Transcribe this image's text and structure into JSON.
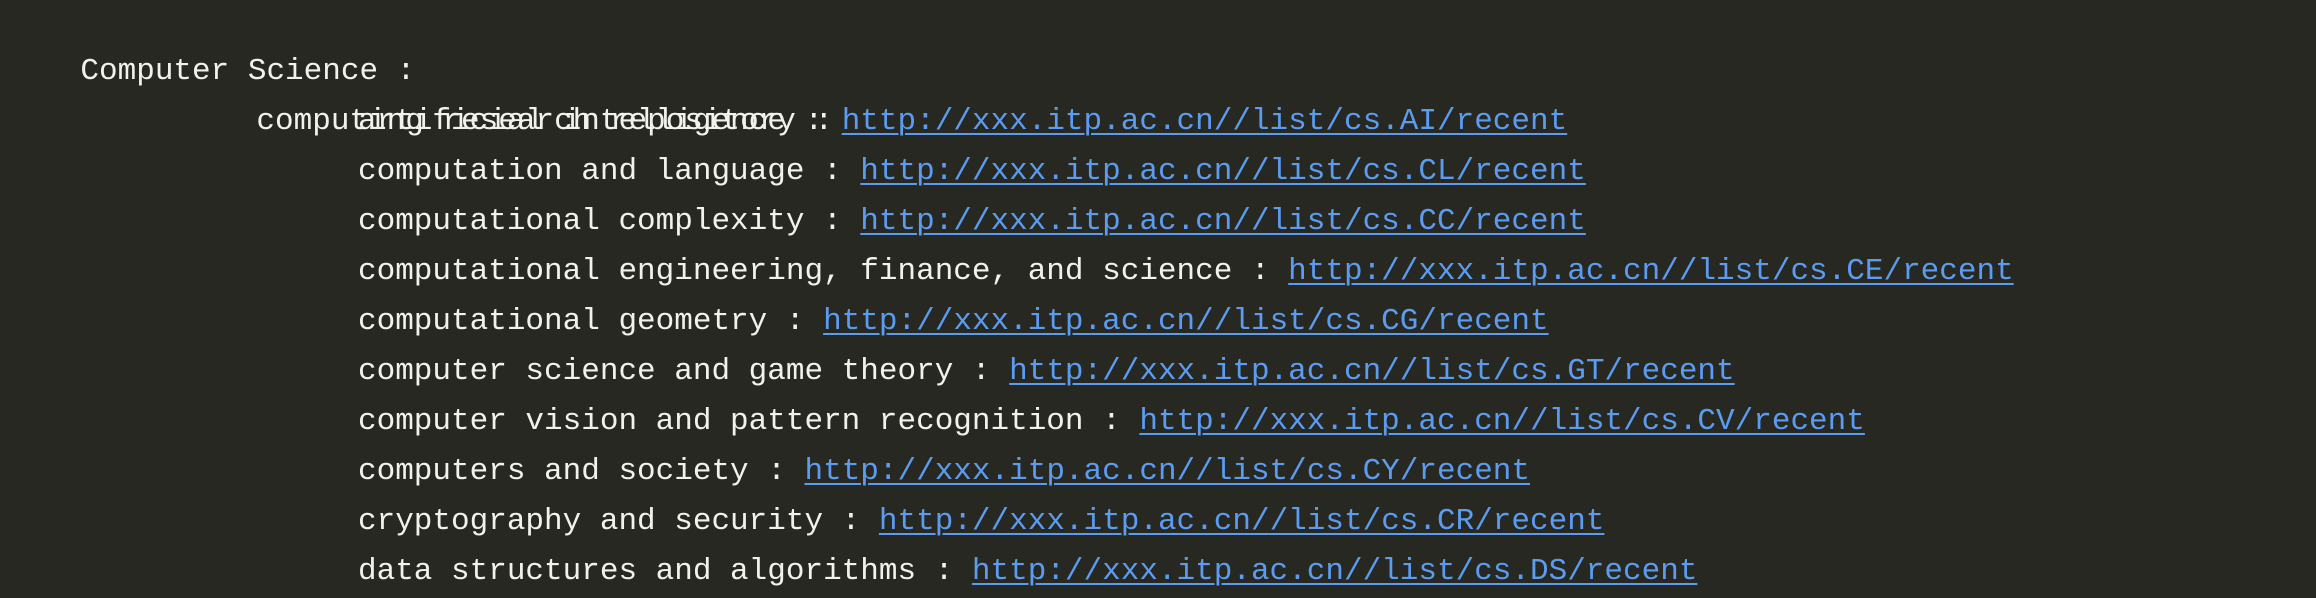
{
  "category": {
    "label": "Computer Science :"
  },
  "subcategory": {
    "label": "computing research repository :"
  },
  "topics": [
    {
      "label": "artificial intelligence :",
      "url": "http://xxx.itp.ac.cn//list/cs.AI/recent"
    },
    {
      "label": "computation and language :",
      "url": "http://xxx.itp.ac.cn//list/cs.CL/recent"
    },
    {
      "label": "computational complexity :",
      "url": "http://xxx.itp.ac.cn//list/cs.CC/recent"
    },
    {
      "label": "computational engineering, finance, and science :",
      "url": "http://xxx.itp.ac.cn//list/cs.CE/recent"
    },
    {
      "label": "computational geometry :",
      "url": "http://xxx.itp.ac.cn//list/cs.CG/recent"
    },
    {
      "label": "computer science and game theory :",
      "url": "http://xxx.itp.ac.cn//list/cs.GT/recent"
    },
    {
      "label": "computer vision and pattern recognition :",
      "url": "http://xxx.itp.ac.cn//list/cs.CV/recent"
    },
    {
      "label": "computers and society :",
      "url": "http://xxx.itp.ac.cn//list/cs.CY/recent"
    },
    {
      "label": "cryptography and security :",
      "url": "http://xxx.itp.ac.cn//list/cs.CR/recent"
    },
    {
      "label": "data structures and algorithms :",
      "url": "http://xxx.itp.ac.cn//list/cs.DS/recent"
    }
  ],
  "colors": {
    "background": "#272822",
    "text": "#f2f2ec",
    "link": "#5b9bf0"
  }
}
